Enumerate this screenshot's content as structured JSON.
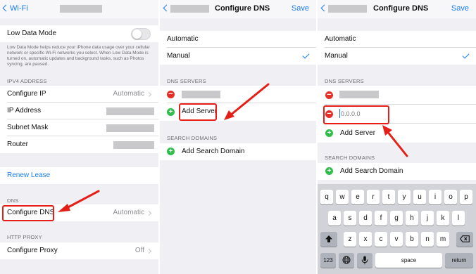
{
  "panel1": {
    "back_label": "Wi-Fi",
    "low_data_mode": {
      "label": "Low Data Mode",
      "enabled": false,
      "description": "Low Data Mode helps reduce your iPhone data usage over your cellular network or specific Wi-Fi networks you select. When Low Data Mode is turned on, automatic updates and background tasks, such as Photos syncing, are paused."
    },
    "ipv4_header": "IPV4 ADDRESS",
    "configure_ip": {
      "label": "Configure IP",
      "value": "Automatic"
    },
    "ip_address_label": "IP Address",
    "subnet_mask_label": "Subnet Mask",
    "router_label": "Router",
    "renew_lease": "Renew Lease",
    "dns_header": "DNS",
    "configure_dns": {
      "label": "Configure DNS",
      "value": "Automatic"
    },
    "http_proxy_header": "HTTP PROXY",
    "configure_proxy": {
      "label": "Configure Proxy",
      "value": "Off"
    }
  },
  "panel2": {
    "title": "Configure DNS",
    "save_label": "Save",
    "automatic_label": "Automatic",
    "manual_label": "Manual",
    "selected_mode": "Manual",
    "dns_servers_header": "DNS SERVERS",
    "add_server_label": "Add Server",
    "search_domains_header": "SEARCH DOMAINS",
    "add_search_domain_label": "Add Search Domain"
  },
  "panel3": {
    "title": "Configure DNS",
    "save_label": "Save",
    "automatic_label": "Automatic",
    "manual_label": "Manual",
    "selected_mode": "Manual",
    "dns_servers_header": "DNS SERVERS",
    "new_server_placeholder": "0.0.0.0",
    "add_server_label": "Add Server",
    "search_domains_header": "SEARCH DOMAINS",
    "add_search_domain_label": "Add Search Domain"
  },
  "keyboard": {
    "row1": [
      "q",
      "w",
      "e",
      "r",
      "t",
      "y",
      "u",
      "i",
      "o",
      "p"
    ],
    "row2": [
      "a",
      "s",
      "d",
      "f",
      "g",
      "h",
      "j",
      "k",
      "l"
    ],
    "row3": [
      "z",
      "x",
      "c",
      "v",
      "b",
      "n",
      "m"
    ],
    "numbers_label": "123",
    "space_label": "space",
    "return_label": "return",
    "shift_icon": "shift-icon",
    "delete_icon": "delete-icon",
    "globe_icon": "globe-icon",
    "mic_icon": "mic-icon"
  },
  "colors": {
    "accent": "#1a7cf5",
    "highlight": "#e51e17",
    "delete_red": "#e5302a",
    "add_green": "#2fbf4a"
  }
}
